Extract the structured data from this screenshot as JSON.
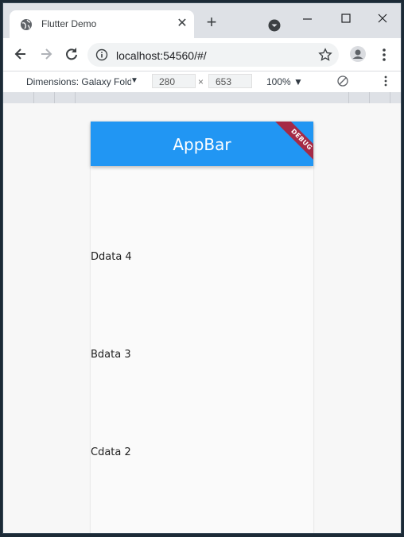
{
  "browser": {
    "tab_title": "Flutter Demo",
    "tab_close": "✕",
    "new_tab": "+",
    "url": "localhost:54560/#/"
  },
  "devtools": {
    "dimensions_label": "Dimensions: Galaxy Fold",
    "width_value": "280",
    "times": "×",
    "height_value": "653",
    "zoom": "100% ▼"
  },
  "app": {
    "appbar_title": "AppBar",
    "debug_banner": "DEBUG",
    "primary_color": "#2196f3",
    "items": [
      {
        "label": "Ddata 4"
      },
      {
        "label": "Bdata 3"
      },
      {
        "label": "Cdata 2"
      }
    ]
  }
}
